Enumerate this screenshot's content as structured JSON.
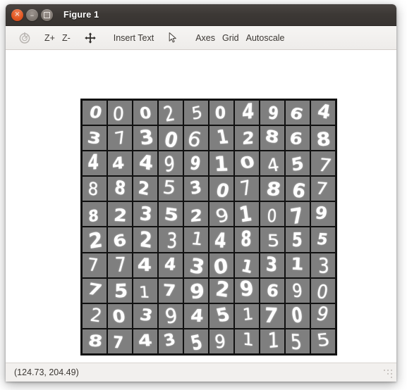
{
  "window": {
    "title": "Figure 1",
    "controls": [
      {
        "name": "close",
        "glyph": "×"
      },
      {
        "name": "minimize",
        "glyph": "–"
      },
      {
        "name": "maximize",
        "glyph": "□"
      }
    ]
  },
  "toolbar": {
    "reset_icon": "reset-view-icon",
    "zoom_in_label": "Z+",
    "zoom_out_label": "Z-",
    "pan_icon": "pan-move-icon",
    "insert_text_label": "Insert Text",
    "select_icon": "arrow-cursor-icon",
    "axes_label": "Axes",
    "grid_label": "Grid",
    "autoscale_label": "Autoscale"
  },
  "statusbar": {
    "coordinates": "(124.73, 204.49)"
  },
  "chart_data": {
    "type": "heatmap",
    "title": "",
    "xlabel": "",
    "ylabel": "",
    "grid": true,
    "legend_position": "none",
    "description": "10x10 montage of handwritten MNIST digit images, white strokes on gray tiles separated by black gridlines",
    "rows": 10,
    "cols": 10,
    "tile_background": "#7f7f7f",
    "stroke_color": "#ffffff",
    "gridline_color": "#111111",
    "values": [
      [
        0,
        0,
        0,
        2,
        5,
        0,
        4,
        9,
        6,
        4
      ],
      [
        3,
        7,
        3,
        0,
        6,
        1,
        2,
        8,
        6,
        8
      ],
      [
        4,
        4,
        4,
        9,
        9,
        1,
        0,
        4,
        5,
        7
      ],
      [
        8,
        8,
        2,
        5,
        3,
        0,
        7,
        8,
        6,
        7
      ],
      [
        8,
        2,
        3,
        5,
        2,
        9,
        1,
        0,
        7,
        9
      ],
      [
        2,
        6,
        2,
        3,
        1,
        4,
        8,
        5,
        5,
        5
      ],
      [
        7,
        7,
        4,
        4,
        3,
        0,
        1,
        3,
        1,
        3
      ],
      [
        7,
        5,
        1,
        7,
        9,
        2,
        9,
        6,
        9,
        0
      ],
      [
        2,
        0,
        3,
        9,
        4,
        5,
        1,
        7,
        0,
        9
      ],
      [
        8,
        7,
        4,
        3,
        5,
        9,
        1,
        1,
        5,
        5
      ]
    ]
  },
  "colors": {
    "titlebar": "#3c3835",
    "toolbar": "#f0eeec",
    "canvas": "#ffffff",
    "close_button": "#e25822",
    "accent_text": "#3c3834"
  }
}
